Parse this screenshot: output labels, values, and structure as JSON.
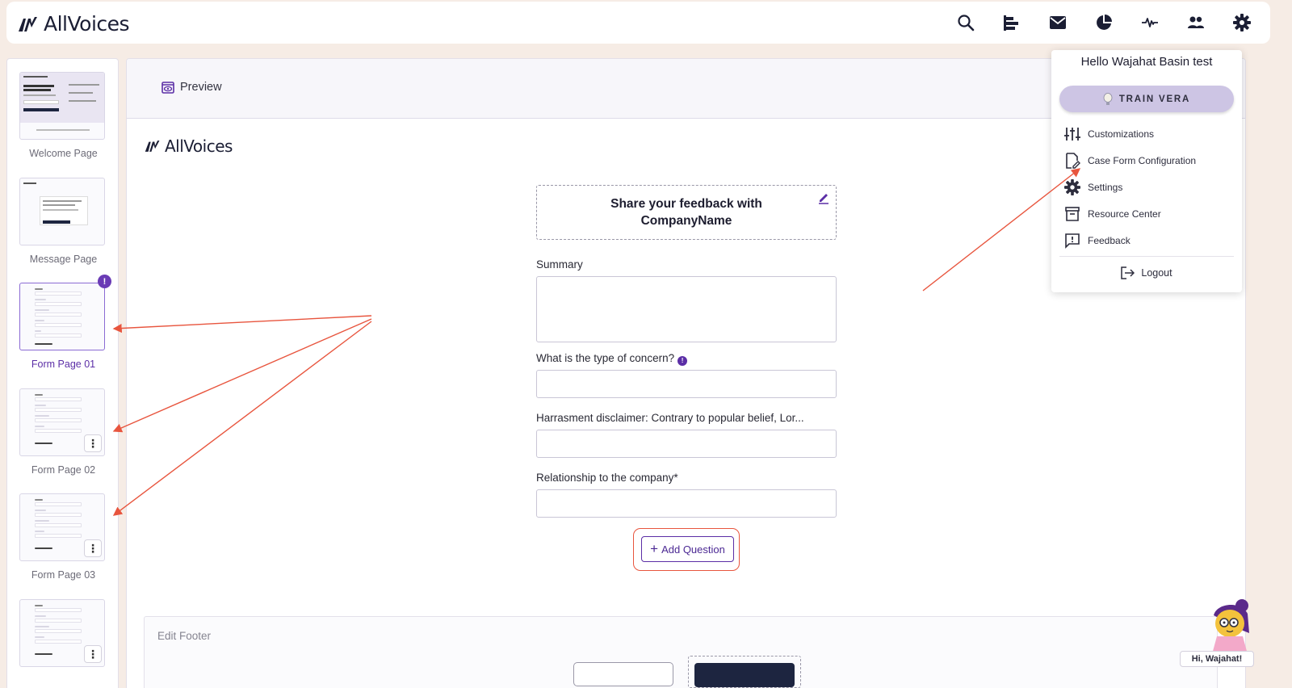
{
  "app": {
    "name": "AllVoices"
  },
  "header": {
    "icons": [
      "search-icon",
      "align-left-icon",
      "mail-icon",
      "pie-chart-icon",
      "activity-icon",
      "users-icon",
      "gear-icon"
    ]
  },
  "sidebar": {
    "pages": [
      {
        "label": "Welcome Page",
        "active": false
      },
      {
        "label": "Message Page",
        "active": false
      },
      {
        "label": "Form Page 01",
        "active": true,
        "badge": "!"
      },
      {
        "label": "Form Page 02",
        "active": false
      },
      {
        "label": "Form Page 03",
        "active": false
      },
      {
        "label": "",
        "active": false
      }
    ]
  },
  "editor": {
    "preview_label": "Preview",
    "form_logo": "AllVoices",
    "form_title": "Share your feedback with CompanyName",
    "questions": [
      {
        "label": "Summary",
        "info": false
      },
      {
        "label": "What is the type of concern?",
        "info": true
      },
      {
        "label": "Harrasment disclaimer: Contrary to popular belief, Lor...",
        "info": false
      },
      {
        "label": "Relationship to the company*",
        "info": false
      }
    ],
    "add_question_label": "Add Question",
    "footer_label": "Edit Footer"
  },
  "menu": {
    "greeting": "Hello Wajahat Basin test",
    "train_label": "TRAIN VERA",
    "items": [
      {
        "label": "Customizations",
        "icon": "sliders-icon"
      },
      {
        "label": "Case Form Configuration",
        "icon": "file-edit-icon"
      },
      {
        "label": "Settings",
        "icon": "gear-icon"
      },
      {
        "label": "Resource Center",
        "icon": "archive-icon"
      },
      {
        "label": "Feedback",
        "icon": "feedback-icon"
      }
    ],
    "logout_label": "Logout"
  },
  "assistant": {
    "greeting": "Hi, Wajahat!"
  },
  "colors": {
    "brand_purple": "#5b2ea6",
    "navy": "#1b1e34",
    "annotation_red": "#e8553e",
    "background": "#f6ece5"
  }
}
